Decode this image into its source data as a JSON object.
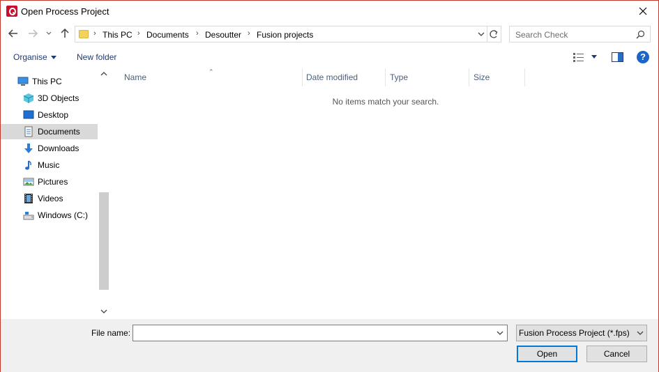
{
  "window": {
    "title": "Open Process Project"
  },
  "address": {
    "crumbs": [
      "This PC",
      "Documents",
      "Desoutter",
      "Fusion projects"
    ]
  },
  "search": {
    "placeholder": "Search Check"
  },
  "toolbar": {
    "organise_label": "Organise",
    "new_folder_label": "New folder"
  },
  "nav": {
    "items": [
      {
        "label": "This PC",
        "icon": "monitor-icon"
      },
      {
        "label": "3D Objects",
        "icon": "cube-icon"
      },
      {
        "label": "Desktop",
        "icon": "desktop-icon"
      },
      {
        "label": "Documents",
        "icon": "documents-icon",
        "selected": true
      },
      {
        "label": "Downloads",
        "icon": "download-arrow-icon"
      },
      {
        "label": "Music",
        "icon": "music-note-icon"
      },
      {
        "label": "Pictures",
        "icon": "pictures-icon"
      },
      {
        "label": "Videos",
        "icon": "film-icon"
      },
      {
        "label": "Windows (C:)",
        "icon": "drive-icon"
      }
    ]
  },
  "columns": {
    "name": "Name",
    "date_modified": "Date modified",
    "type": "Type",
    "size": "Size"
  },
  "content": {
    "empty_message": "No items match your search."
  },
  "footer": {
    "file_name_label": "File name:",
    "file_name_value": "",
    "file_type_selected": "Fusion Process Project (*.fps)",
    "open_label": "Open",
    "cancel_label": "Cancel"
  },
  "colors": {
    "accent": "#0078d7",
    "window_border": "#c0392b",
    "app_icon": "#c8102e"
  }
}
